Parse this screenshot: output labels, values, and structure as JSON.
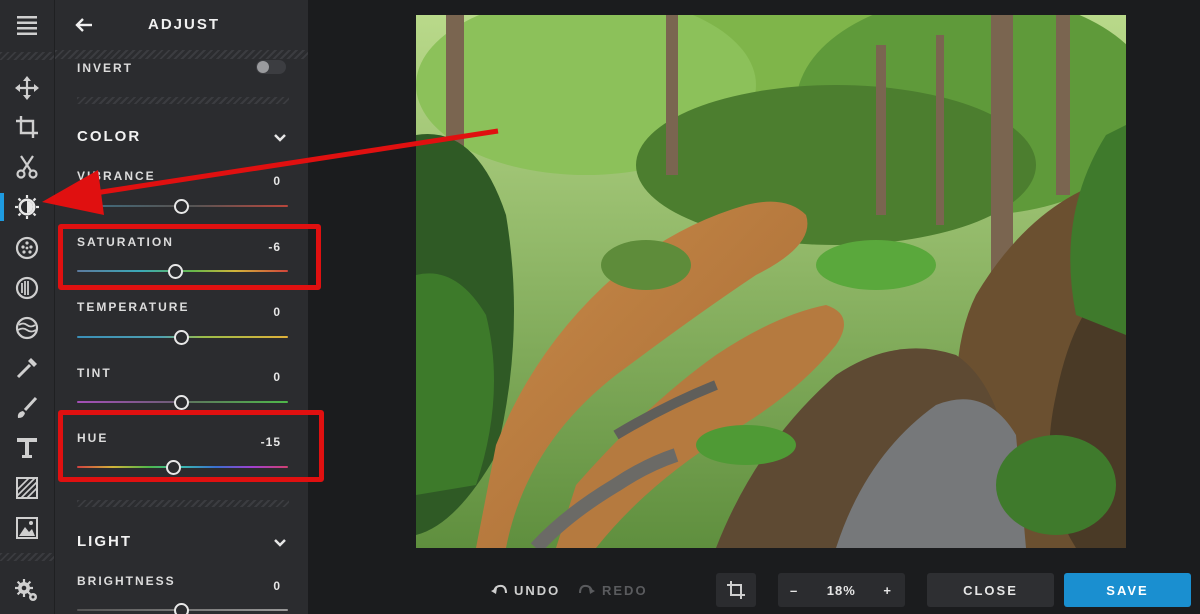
{
  "panel": {
    "title": "ADJUST",
    "invert_label": "INVERT",
    "color_section": "COLOR",
    "light_section": "LIGHT",
    "sliders": {
      "vibrance": {
        "label": "VIBRANCE",
        "value": "0"
      },
      "saturation": {
        "label": "SATURATION",
        "value": "-6"
      },
      "temperature": {
        "label": "TEMPERATURE",
        "value": "0"
      },
      "tint": {
        "label": "TINT",
        "value": "0"
      },
      "hue": {
        "label": "HUE",
        "value": "-15"
      },
      "brightness": {
        "label": "BRIGHTNESS",
        "value": "0"
      }
    }
  },
  "rail": {
    "tools": [
      "menu-icon",
      "move-icon",
      "crop-icon",
      "cut-icon",
      "adjust-icon",
      "filter-icon",
      "frame-icon",
      "texture-icon",
      "eyedropper-icon",
      "brush-icon",
      "text-icon",
      "pattern-icon",
      "image-icon",
      "settings-icon"
    ]
  },
  "toolbar": {
    "undo": "UNDO",
    "redo": "REDO",
    "zoom_minus": "–",
    "zoom": "18%",
    "zoom_plus": "+",
    "close": "CLOSE",
    "save": "SAVE"
  },
  "colors": {
    "accent": "#1e9be0",
    "highlight": "#e01010",
    "save_bg": "#1a8fd0"
  }
}
